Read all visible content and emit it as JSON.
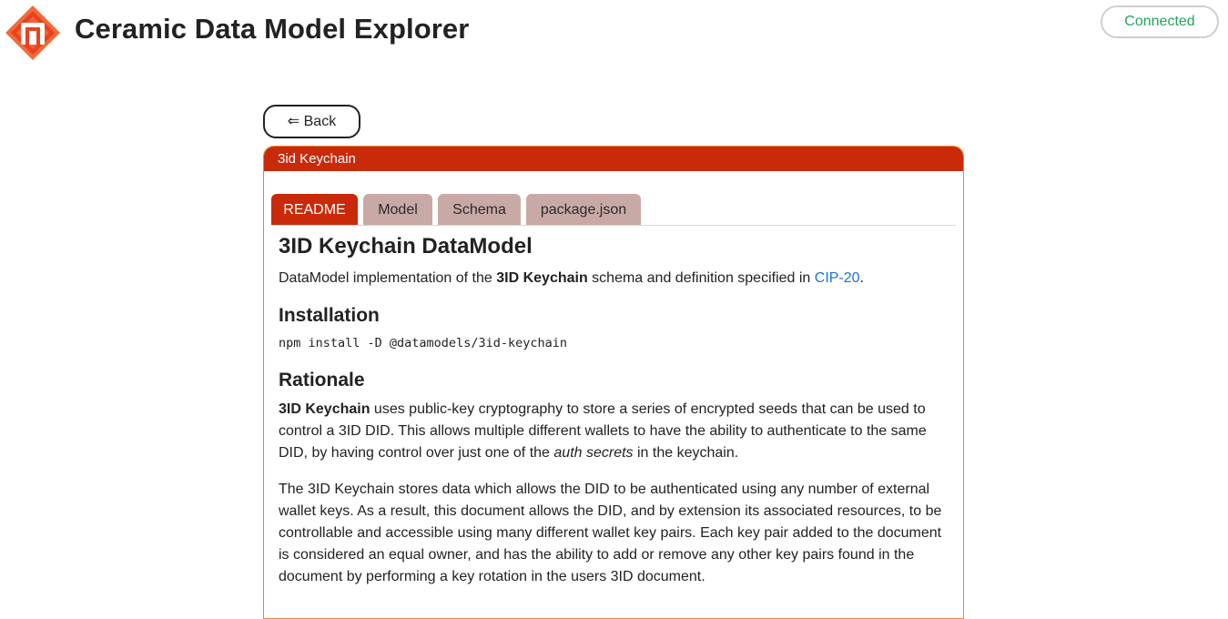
{
  "app": {
    "title": "Ceramic Data Model Explorer",
    "logo_icon": "ceramic-logo-icon",
    "status": "Connected",
    "colors": {
      "brand_red": "#c92a0a",
      "status_green": "#22a55a",
      "link_blue": "#1a73d6",
      "card_border": "#e48a2a",
      "inactive_tab": "#c9a9a6"
    }
  },
  "nav": {
    "back_label": "⇐ Back"
  },
  "card": {
    "title": "3id Keychain",
    "tabs": [
      {
        "label": "README",
        "active": true
      },
      {
        "label": "Model",
        "active": false
      },
      {
        "label": "Schema",
        "active": false
      },
      {
        "label": "package.json",
        "active": false
      }
    ]
  },
  "readme": {
    "heading": "3ID Keychain DataModel",
    "intro_prefix": "DataModel implementation of the ",
    "intro_bold": "3ID Keychain",
    "intro_middle": " schema and definition specified in ",
    "intro_link": "CIP-20",
    "intro_suffix": ".",
    "installation_heading": "Installation",
    "install_command": "npm install -D @datamodels/3id-keychain",
    "rationale_heading": "Rationale",
    "rationale_p1_bold": "3ID Keychain",
    "rationale_p1_a": " uses public-key cryptography to store a series of encrypted seeds that can be used to control a 3ID DID. This allows multiple different wallets to have the ability to authenticate to the same DID, by having control over just one of the ",
    "rationale_p1_italic": "auth secrets",
    "rationale_p1_b": " in the keychain.",
    "rationale_p2": "The 3ID Keychain stores data which allows the DID to be authenticated using any number of external wallet keys. As a result, this document allows the DID, and by extension its associated resources, to be controllable and accessible using many different wallet key pairs. Each key pair added to the document is considered an equal owner, and has the ability to add or remove any other key pairs found in the document by performing a key rotation in the users 3ID document."
  }
}
